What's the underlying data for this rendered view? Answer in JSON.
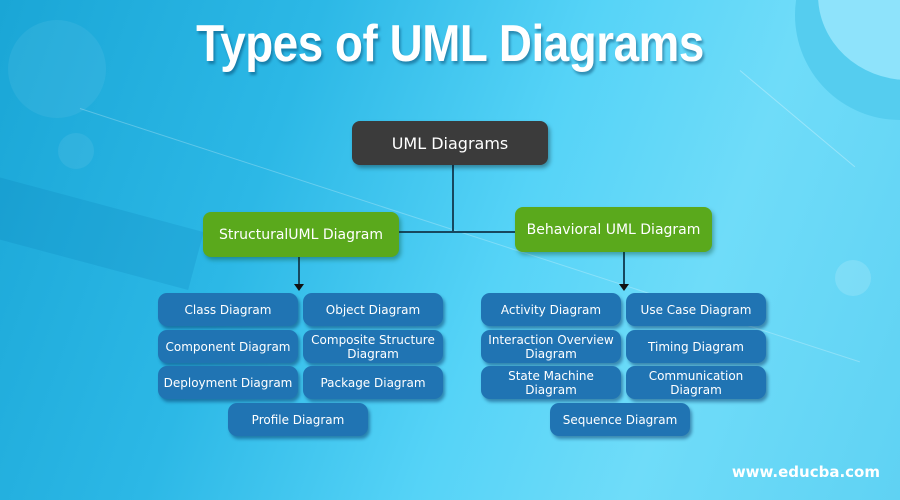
{
  "title": "Types of UML Diagrams",
  "root": {
    "label": "UML Diagrams"
  },
  "categories": {
    "structural": {
      "label": "StructuralUML Diagram",
      "items": [
        "Class Diagram",
        "Object Diagram",
        "Component Diagram",
        "Composite Structure Diagram",
        "Deployment Diagram",
        "Package Diagram",
        "Profile Diagram"
      ]
    },
    "behavioral": {
      "label": "Behavioral UML Diagram",
      "items": [
        "Activity Diagram",
        "Use Case Diagram",
        "Interaction Overview Diagram",
        "Timing Diagram",
        "State Machine Diagram",
        "Communication Diagram",
        "Sequence Diagram"
      ]
    }
  },
  "watermark": "www.educba.com",
  "colors": {
    "root_box": "#3b3b3b",
    "category_box": "#5aa91c",
    "leaf_box": "#2074b3",
    "connector": "#17485f",
    "background": "#2cb8e6"
  }
}
